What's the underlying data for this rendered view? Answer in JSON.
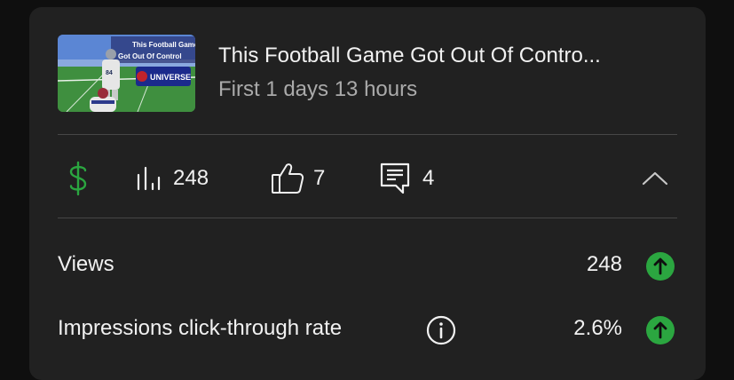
{
  "video": {
    "title": "This Football Game Got Out Of Contro...",
    "subtitle": "First 1 days 13 hours",
    "thumbnail": {
      "caption_line1": "This Football Game",
      "caption_line2": "Got Out Of Control",
      "badge": "UNIVERSE",
      "jersey": "84"
    }
  },
  "stats": {
    "revenue_icon": "dollar-icon",
    "views": "248",
    "likes": "7",
    "comments": "4"
  },
  "metrics": [
    {
      "label": "Views",
      "value": "248",
      "trend": "up"
    },
    {
      "label": "Impressions click-through rate",
      "value": "2.6%",
      "trend": "up"
    }
  ],
  "colors": {
    "card_bg": "#212121",
    "page_bg": "#0f0f0f",
    "money_green": "#2ba640",
    "trend_green": "#2ba640",
    "divider": "#474747"
  }
}
